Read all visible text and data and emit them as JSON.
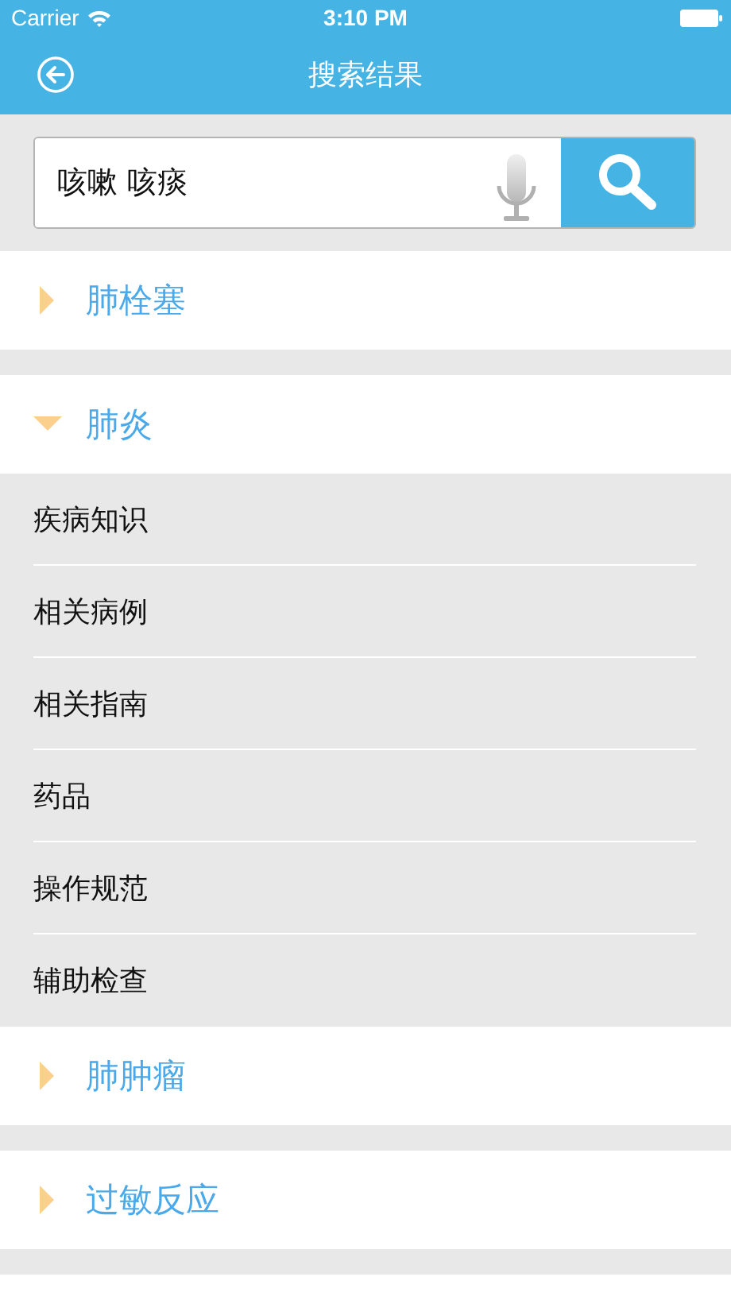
{
  "status_bar": {
    "carrier": "Carrier",
    "time": "3:10 PM"
  },
  "nav": {
    "title": "搜索结果"
  },
  "search": {
    "value": "咳嗽 咳痰"
  },
  "groups": [
    {
      "title": "肺栓塞",
      "expanded": false
    },
    {
      "title": "肺炎",
      "expanded": true,
      "children": [
        {
          "label": "疾病知识"
        },
        {
          "label": "相关病例"
        },
        {
          "label": "相关指南"
        },
        {
          "label": "药品"
        },
        {
          "label": "操作规范"
        },
        {
          "label": "辅助检查"
        }
      ]
    },
    {
      "title": "肺肿瘤",
      "expanded": false
    },
    {
      "title": "过敏反应",
      "expanded": false
    }
  ]
}
